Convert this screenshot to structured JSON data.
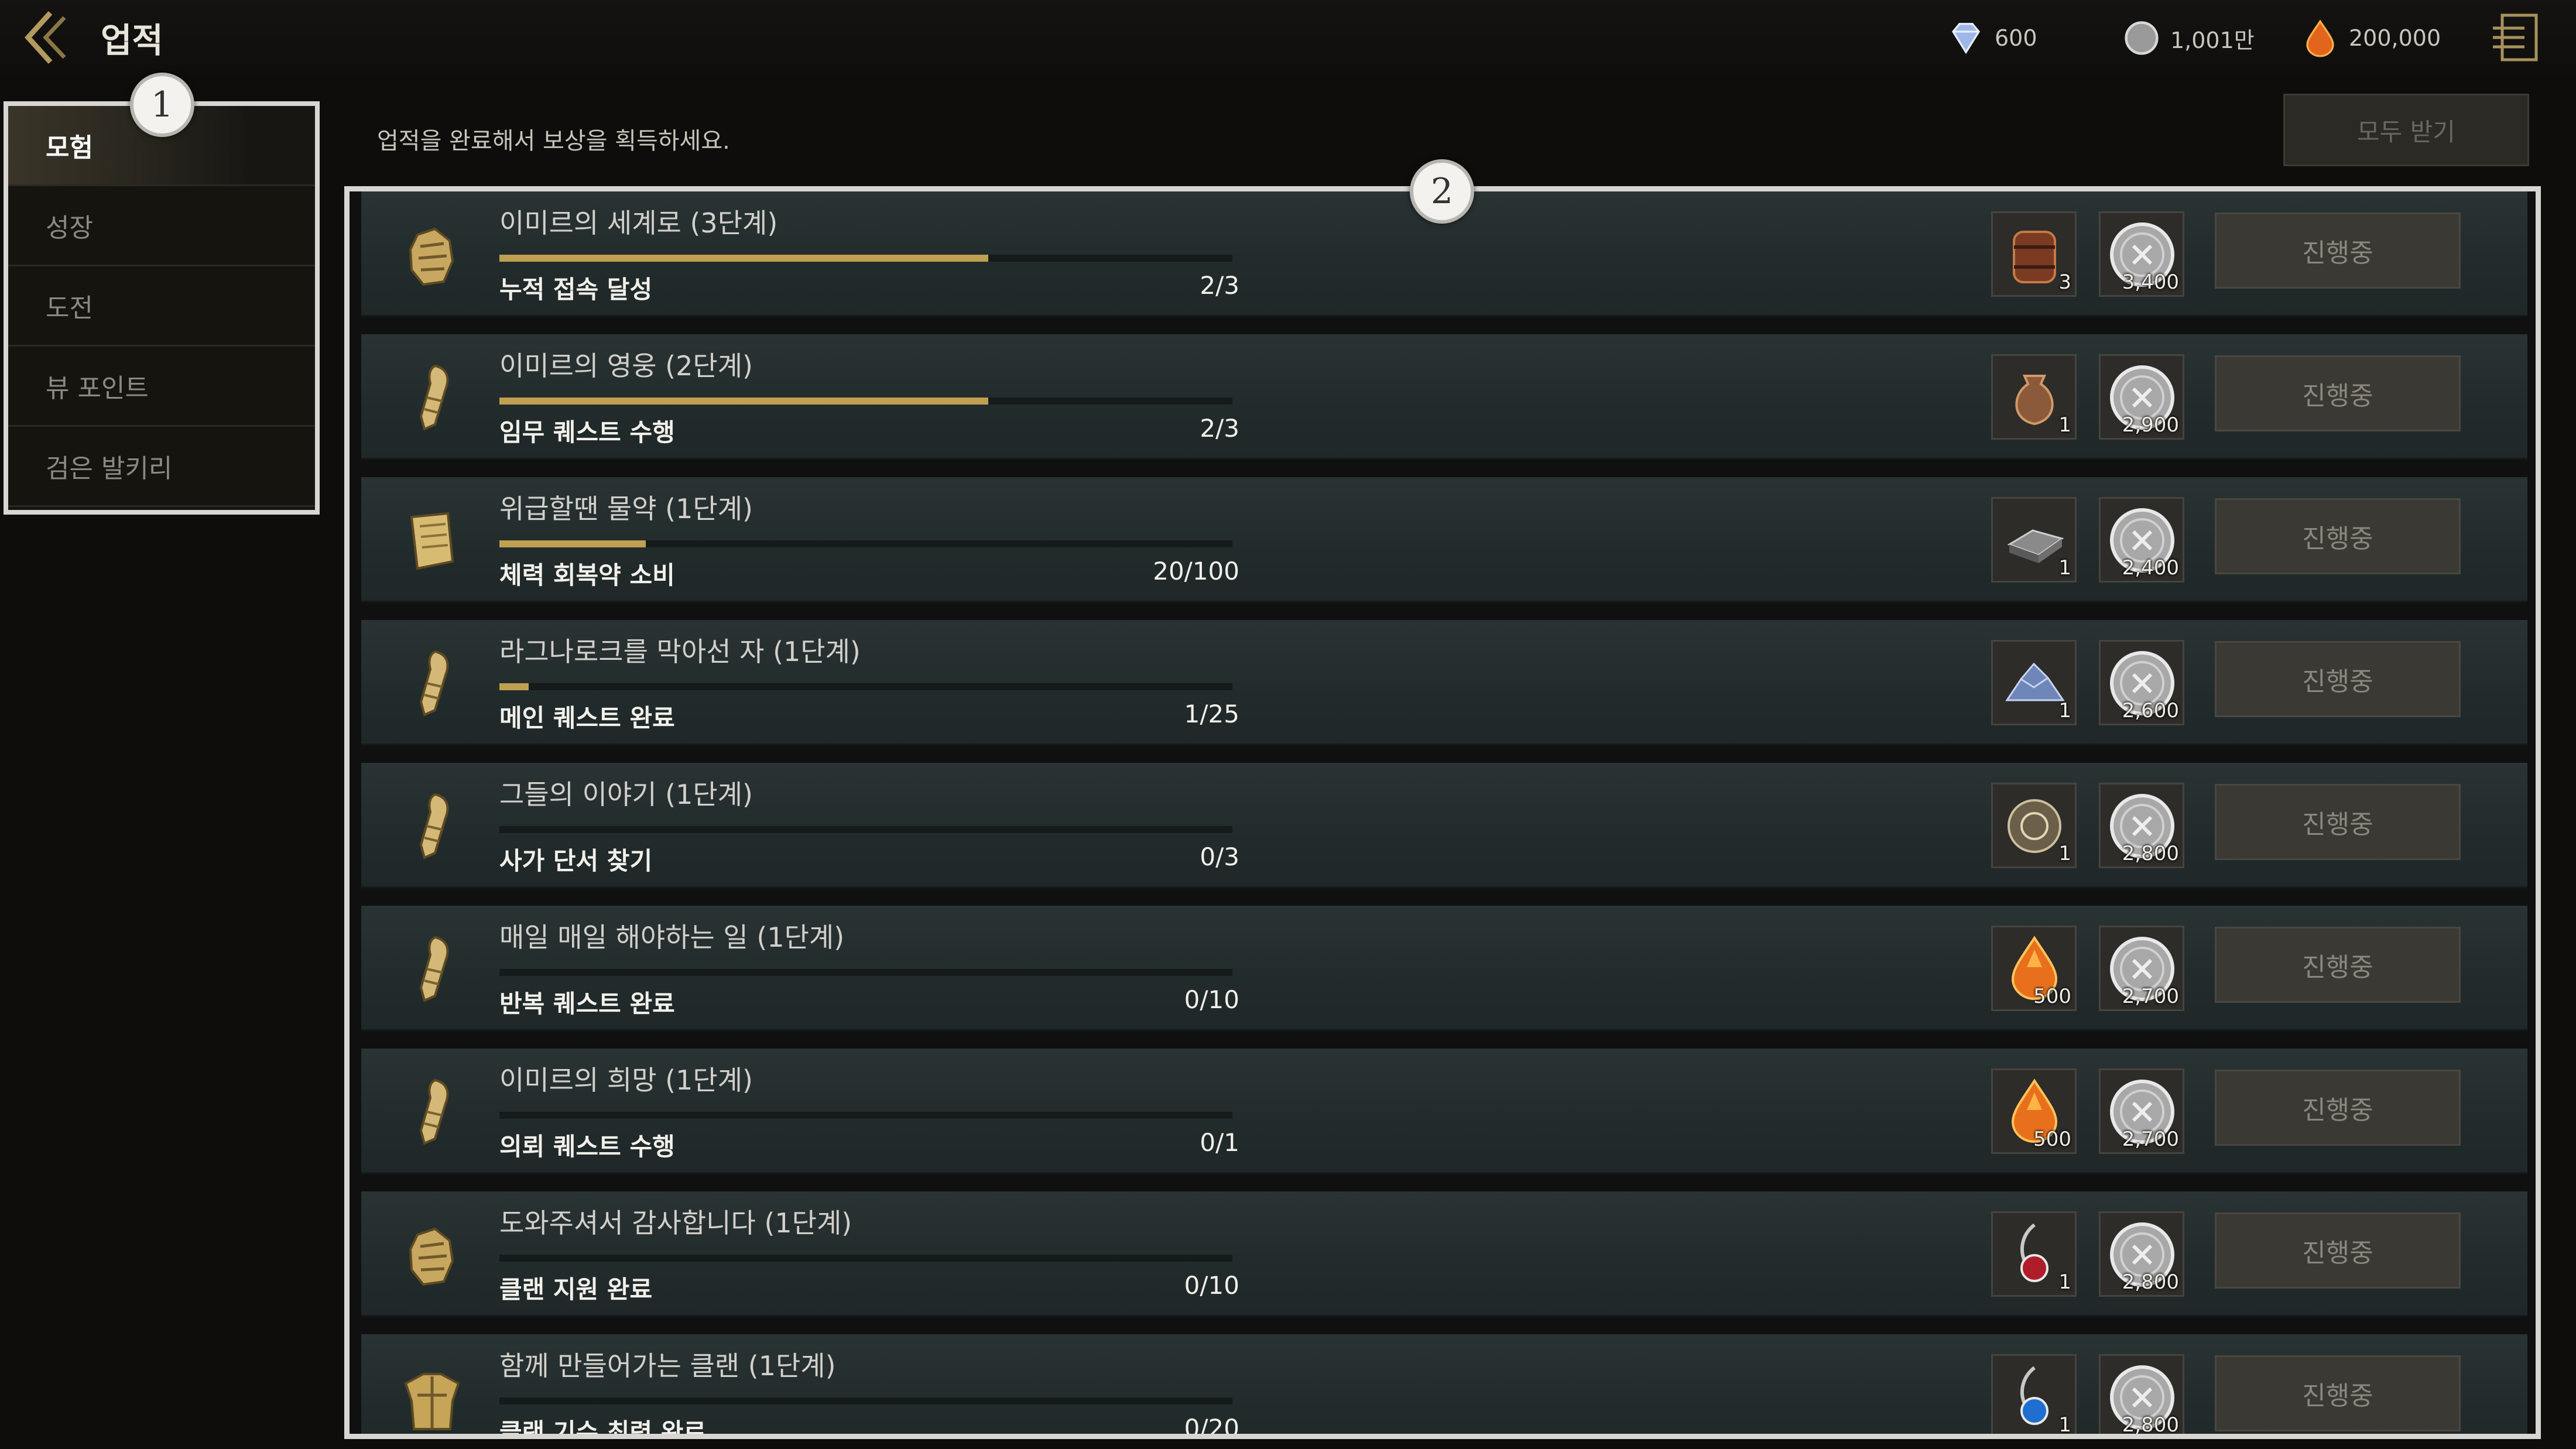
{
  "header": {
    "title": "업적",
    "currencies": [
      {
        "icon": "diamond-icon",
        "value": "600"
      },
      {
        "icon": "silver-coin-icon",
        "value": "1,001만"
      },
      {
        "icon": "amber-gem-icon",
        "value": "200,000"
      }
    ]
  },
  "sidebar": {
    "items": [
      {
        "label": "모험",
        "active": true
      },
      {
        "label": "성장",
        "active": false
      },
      {
        "label": "도전",
        "active": false
      },
      {
        "label": "뷰 포인트",
        "active": false
      },
      {
        "label": "검은 발키리",
        "active": false
      }
    ]
  },
  "callouts": [
    "1",
    "2"
  ],
  "main": {
    "instruction": "업적을 완료해서 보상을 획득하세요.",
    "receive_all_label": "모두 받기",
    "achievements": [
      {
        "icon": "gauntlet-icon",
        "title": "이미르의 세계로 (3단계)",
        "desc": "누적 접속 달성",
        "count": "2/3",
        "progress": 0.667,
        "rewards": [
          {
            "icon": "barrel-chest-icon",
            "qty": "3"
          },
          {
            "icon": "silver-coin-icon",
            "qty": "3,400"
          }
        ],
        "button": "진행중"
      },
      {
        "icon": "scroll-icon",
        "title": "이미르의 영웅 (2단계)",
        "desc": "임무 퀘스트 수행",
        "count": "2/3",
        "progress": 0.667,
        "rewards": [
          {
            "icon": "pouch-icon",
            "qty": "1"
          },
          {
            "icon": "silver-coin-icon",
            "qty": "2,900"
          }
        ],
        "button": "진행중"
      },
      {
        "icon": "book-icon",
        "title": "위급할땐 물약 (1단계)",
        "desc": "체력 회복약 소비",
        "count": "20/100",
        "progress": 0.2,
        "rewards": [
          {
            "icon": "iron-ingot-icon",
            "qty": "1"
          },
          {
            "icon": "silver-coin-icon",
            "qty": "2,400"
          }
        ],
        "button": "진행중"
      },
      {
        "icon": "scroll-icon",
        "title": "라그나로크를 막아선 자 (1단계)",
        "desc": "메인 퀘스트 완료",
        "count": "1/25",
        "progress": 0.04,
        "rewards": [
          {
            "icon": "crystal-ore-icon",
            "qty": "1"
          },
          {
            "icon": "silver-coin-icon",
            "qty": "2,600"
          }
        ],
        "button": "진행중"
      },
      {
        "icon": "scroll-icon",
        "title": "그들의 이야기 (1단계)",
        "desc": "사가 단서 찾기",
        "count": "0/3",
        "progress": 0,
        "rewards": [
          {
            "icon": "seal-icon",
            "qty": "1"
          },
          {
            "icon": "silver-coin-icon",
            "qty": "2,800"
          }
        ],
        "button": "진행중"
      },
      {
        "icon": "scroll-icon",
        "title": "매일 매일 해야하는 일 (1단계)",
        "desc": "반복 퀘스트 완료",
        "count": "0/10",
        "progress": 0,
        "rewards": [
          {
            "icon": "amber-gem-icon",
            "qty": "500"
          },
          {
            "icon": "silver-coin-icon",
            "qty": "2,700"
          }
        ],
        "button": "진행중"
      },
      {
        "icon": "scroll-icon",
        "title": "이미르의 희망 (1단계)",
        "desc": "의뢰 퀘스트 수행",
        "count": "0/1",
        "progress": 0,
        "rewards": [
          {
            "icon": "amber-gem-icon",
            "qty": "500"
          },
          {
            "icon": "silver-coin-icon",
            "qty": "2,700"
          }
        ],
        "button": "진행중"
      },
      {
        "icon": "gauntlet-icon",
        "title": "도와주셔서 감사합니다 (1단계)",
        "desc": "클랜 지원 완료",
        "count": "0/10",
        "progress": 0,
        "rewards": [
          {
            "icon": "red-amulet-icon",
            "qty": "1"
          },
          {
            "icon": "silver-coin-icon",
            "qty": "2,800"
          }
        ],
        "button": "진행중"
      },
      {
        "icon": "armor-icon",
        "title": "함께 만들어가는 클랜 (1단계)",
        "desc": "클랜 기수 최력 완료",
        "count": "0/20",
        "progress": 0,
        "rewards": [
          {
            "icon": "blue-amulet-icon",
            "qty": "1"
          },
          {
            "icon": "silver-coin-icon",
            "qty": "2,800"
          }
        ],
        "button": "진행중"
      }
    ]
  }
}
